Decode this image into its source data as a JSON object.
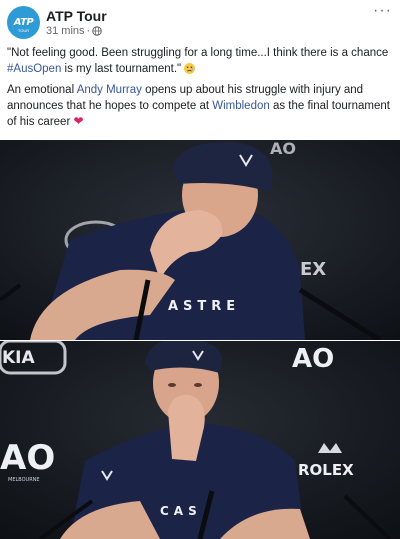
{
  "post": {
    "page_name": "ATP Tour",
    "avatar_text": "ATP",
    "avatar_sub": "TOUR",
    "timestamp": "31 mins",
    "separator": "·",
    "more_label": "···"
  },
  "text": {
    "line1_part1": "\"Not feeling good. Been struggling for a long time...I think there is a chance ",
    "hashtag": "#AusOpen",
    "line1_part2": " is my last tournament.\"",
    "line2_part1": "An emotional ",
    "name_link": "Andy Murray",
    "line2_part2": " opens up about his struggle with injury and announces that he hopes to compete at ",
    "wimbledon_link": "Wimbledon",
    "line2_part3": " as the final tournament of his career"
  },
  "photos": {
    "photo1_shirt_text": "ASTRE",
    "photo1_banner_left": "O",
    "photo1_banner_right": "AO",
    "photo1_right_text": "EX",
    "photo2_banner_left": "KIA",
    "photo2_banner_right": "AO",
    "photo2_left_ao": "AO",
    "photo2_rolex": "ROLEX",
    "photo2_shirt_text": "CAS",
    "logo_sub": "MELBOURNE"
  },
  "colors": {
    "brand_blue": "#2e9bd6",
    "link_blue": "#385898",
    "heart": "#e0245e",
    "shirt": "#1b2447",
    "backdrop": "#101318"
  }
}
